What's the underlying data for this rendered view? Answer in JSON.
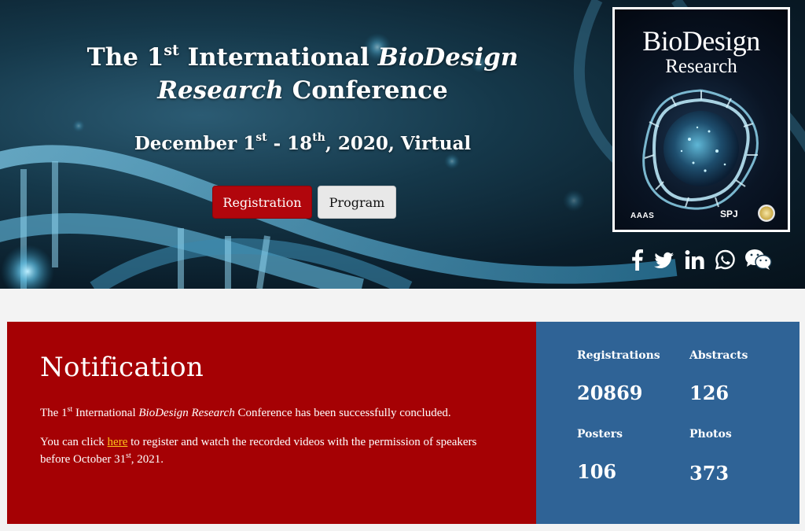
{
  "hero": {
    "title_prefix": "The 1",
    "title_sup": "st",
    "title_mid": " International ",
    "title_italic": "BioDesign Research",
    "title_suffix": " Conference",
    "date_part1": "December 1",
    "date_sup1": "st",
    "date_part2": " - 18",
    "date_sup2": "th",
    "date_part3": ", 2020, Virtual",
    "registration_label": "Registration",
    "program_label": "Program"
  },
  "cover": {
    "title_line1": "BioDesign",
    "title_line2": "Research",
    "publisher_left": "AAAS",
    "publisher_right": "SPJ"
  },
  "social": [
    {
      "name": "facebook-icon"
    },
    {
      "name": "twitter-icon"
    },
    {
      "name": "linkedin-icon"
    },
    {
      "name": "whatsapp-icon"
    },
    {
      "name": "wechat-icon"
    }
  ],
  "notification": {
    "heading": "Notification",
    "p1_a": "The 1",
    "p1_sup": "st",
    "p1_b": " International ",
    "p1_italic": "BioDesign Research",
    "p1_c": " Conference has been successfully concluded.",
    "p2_a": "You can click ",
    "p2_link": "here",
    "p2_b": " to register and watch the recorded videos with the permission of speakers before October 31",
    "p2_sup": "st",
    "p2_c": ", 2021."
  },
  "stats": [
    {
      "label": "Registrations",
      "value": "20869"
    },
    {
      "label": "Abstracts",
      "value": "126"
    },
    {
      "label": "Posters",
      "value": "106"
    },
    {
      "label": "Photos",
      "value": "373"
    }
  ],
  "colors": {
    "notification_bg": "#a50104",
    "stats_bg": "#2f6396",
    "registration_button": "#b1060c",
    "link": "#ffc21a"
  }
}
